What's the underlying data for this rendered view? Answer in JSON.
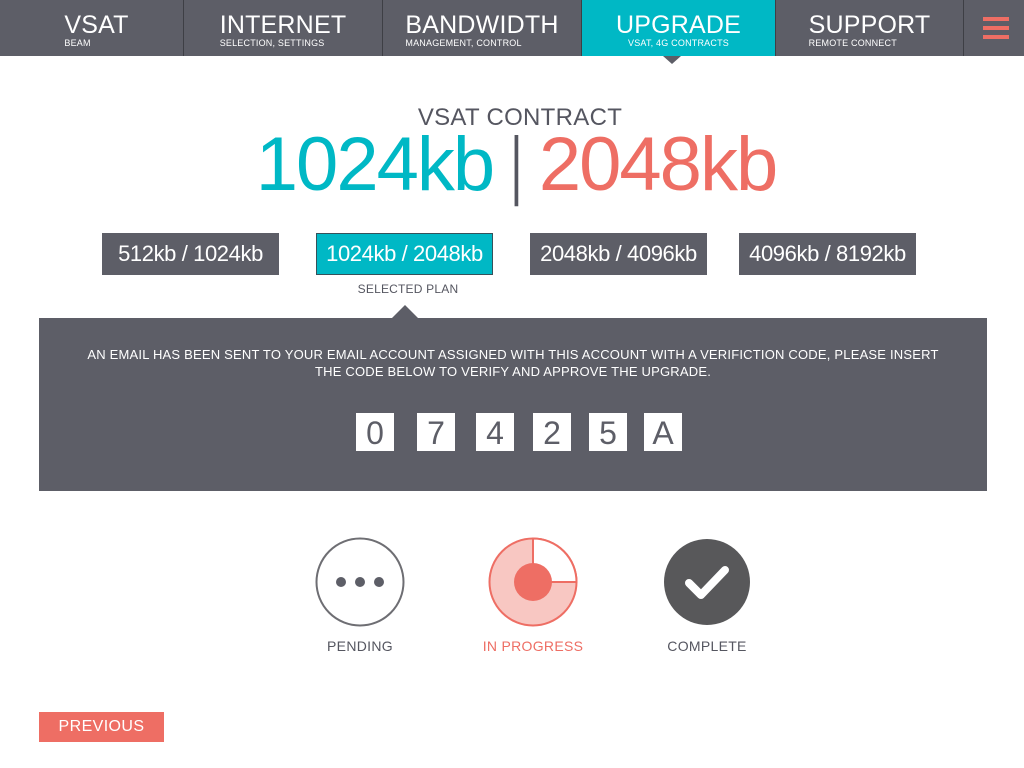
{
  "nav": {
    "tabs": [
      {
        "title": "VSAT",
        "subtitle": "BEAM"
      },
      {
        "title": "INTERNET",
        "subtitle": "SELECTION, SETTINGS"
      },
      {
        "title": "BANDWIDTH",
        "subtitle": "MANAGEMENT, CONTROL"
      },
      {
        "title": "UPGRADE",
        "subtitle": "VSAT, 4G CONTRACTS"
      },
      {
        "title": "SUPPORT",
        "subtitle": "REMOTE CONNECT"
      }
    ],
    "active_tab": "UPGRADE",
    "menu_icon": "hamburger-menu-icon"
  },
  "contract": {
    "label": "VSAT CONTRACT",
    "current_speed": "1024kb",
    "separator": "|",
    "new_speed": "2048kb"
  },
  "plans": {
    "options": [
      "512kb / 1024kb",
      "1024kb / 2048kb",
      "2048kb / 4096kb",
      "4096kb / 8192kb"
    ],
    "selected": "1024kb / 2048kb",
    "selected_note": "SELECTED PLAN"
  },
  "verification": {
    "message": "AN EMAIL HAS BEEN SENT TO YOUR EMAIL ACCOUNT ASSIGNED WITH THIS ACCOUNT WITH A VERIFICTION CODE, PLEASE INSERT THE CODE BELOW TO VERIFY AND APPROVE THE UPGRADE.",
    "code": [
      "0",
      "7",
      "4",
      "2",
      "5",
      "A"
    ]
  },
  "status": {
    "pending": {
      "label": "PENDING",
      "icon": "ellipsis-icon"
    },
    "in_progress": {
      "label": "IN PROGRESS",
      "icon": "progress-icon"
    },
    "complete": {
      "label": "COMPLETE",
      "icon": "checkmark-icon"
    }
  },
  "actions": {
    "previous_label": "PREVIOUS"
  },
  "colors": {
    "accent": "#00b8c5",
    "highlight": "#ee6e64",
    "dark": "#5d5e67",
    "complete": "#58585a"
  }
}
